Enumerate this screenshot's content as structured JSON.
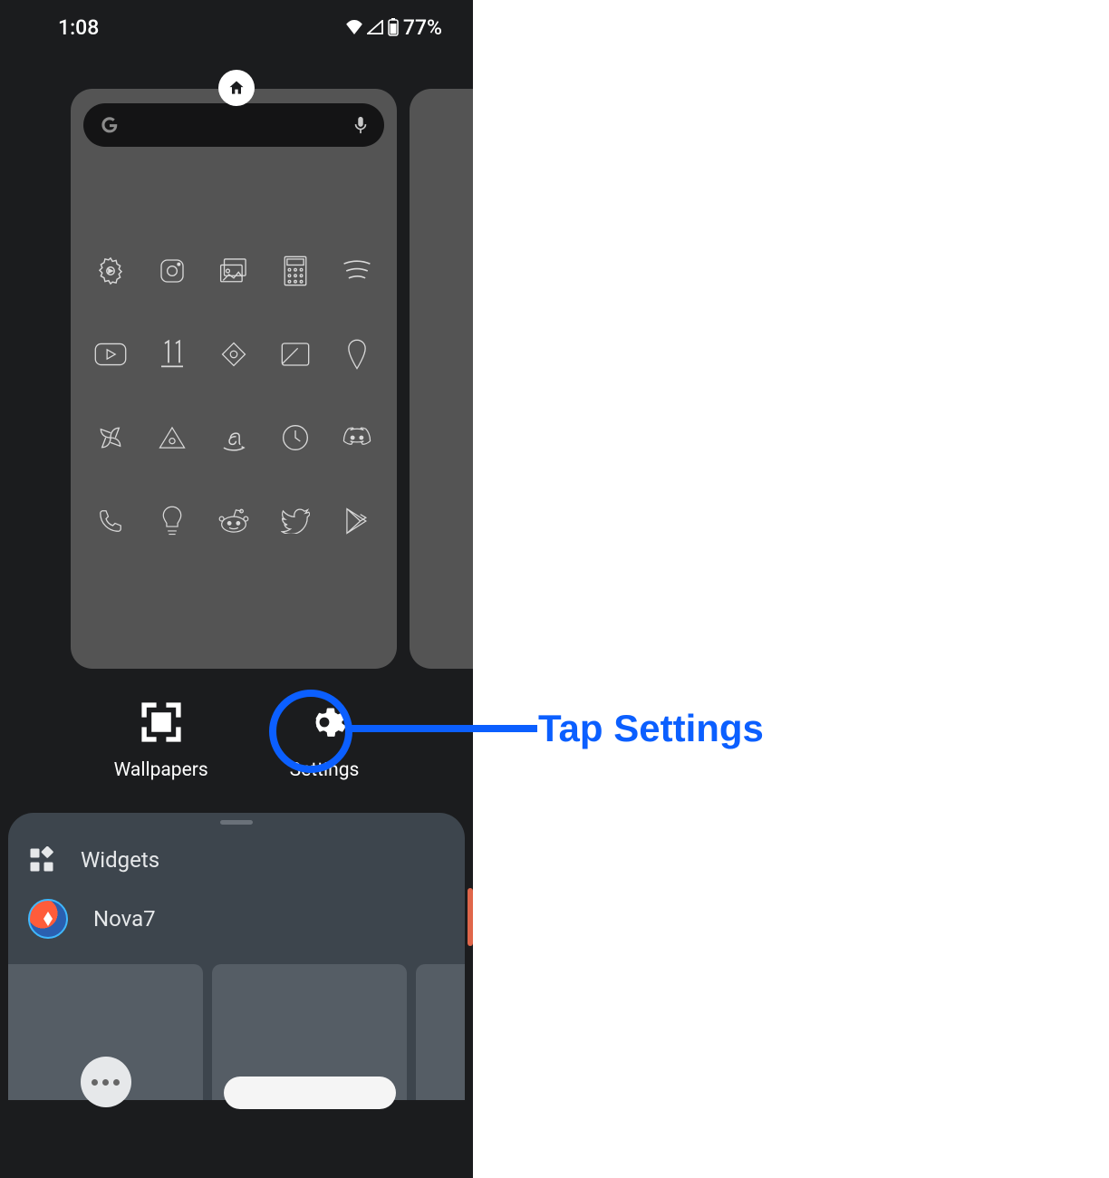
{
  "statusBar": {
    "time": "1:08",
    "battery": "77%"
  },
  "homeBadge": {
    "iconName": "home-icon"
  },
  "searchBar": {
    "logoName": "google-g-icon",
    "micName": "mic-icon"
  },
  "appGrid": {
    "row1": [
      "settings-play-icon",
      "instagram-icon",
      "gallery-icon",
      "calculator-icon",
      "spotify-icon"
    ],
    "row2": [
      "youtube-icon",
      "eleven-icon",
      "diamond-icon",
      "folder-icon",
      "pin-icon"
    ],
    "row3": [
      "pinwheel-icon",
      "triangle-icon",
      "amazon-icon",
      "clock-icon",
      "discord-icon"
    ],
    "row4": [
      "phone-icon",
      "bulb-icon",
      "reddit-icon",
      "twitter-icon",
      "play-store-icon"
    ]
  },
  "appGrid2": [
    "twitch-icon",
    "tiktok-icon",
    "pen-icon",
    "play-alt-icon"
  ],
  "launcherActions": {
    "wallpapers": {
      "label": "Wallpapers",
      "iconName": "wallpaper-icon"
    },
    "settings": {
      "label": "Settings",
      "iconName": "gear-icon"
    }
  },
  "callout": {
    "text": "Tap Settings"
  },
  "drawer": {
    "widgets": {
      "label": "Widgets",
      "iconName": "widgets-icon"
    },
    "nova": {
      "label": "Nova7",
      "iconName": "nova-icon"
    }
  }
}
